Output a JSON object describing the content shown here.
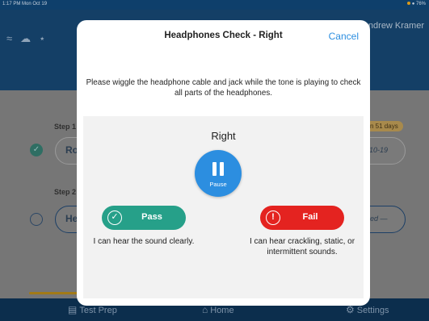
{
  "status": {
    "time": "1:17 PM  Mon Oct 19",
    "battery": "76%"
  },
  "background": {
    "user": "Andrew Kramer",
    "steps": [
      {
        "label": "Step 1",
        "pill_text": "Ro",
        "right_text": "0-10-19",
        "badge": "n 51 days"
      },
      {
        "label": "Step 2",
        "pill_text": "He",
        "right_text": "cked —"
      }
    ],
    "tabs": [
      {
        "label": "Test Prep",
        "icon": "clipboard-icon"
      },
      {
        "label": "Home",
        "icon": "home-icon"
      },
      {
        "label": "Settings",
        "icon": "gear-icon"
      }
    ]
  },
  "modal": {
    "title": "Headphones Check - Right",
    "cancel": "Cancel",
    "instructions": "Please wiggle the headphone cable and jack while the tone is playing to check all parts of the headphones.",
    "side": "Right",
    "pause_label": "Pause",
    "pass_label": "Pass",
    "pass_desc": "I can hear the sound clearly.",
    "fail_label": "Fail",
    "fail_desc": "I can hear crackling, static, or intermittent sounds."
  },
  "colors": {
    "accent": "#2c8ee0",
    "pass": "#26a089",
    "fail": "#e42320",
    "header": "#143f66"
  }
}
